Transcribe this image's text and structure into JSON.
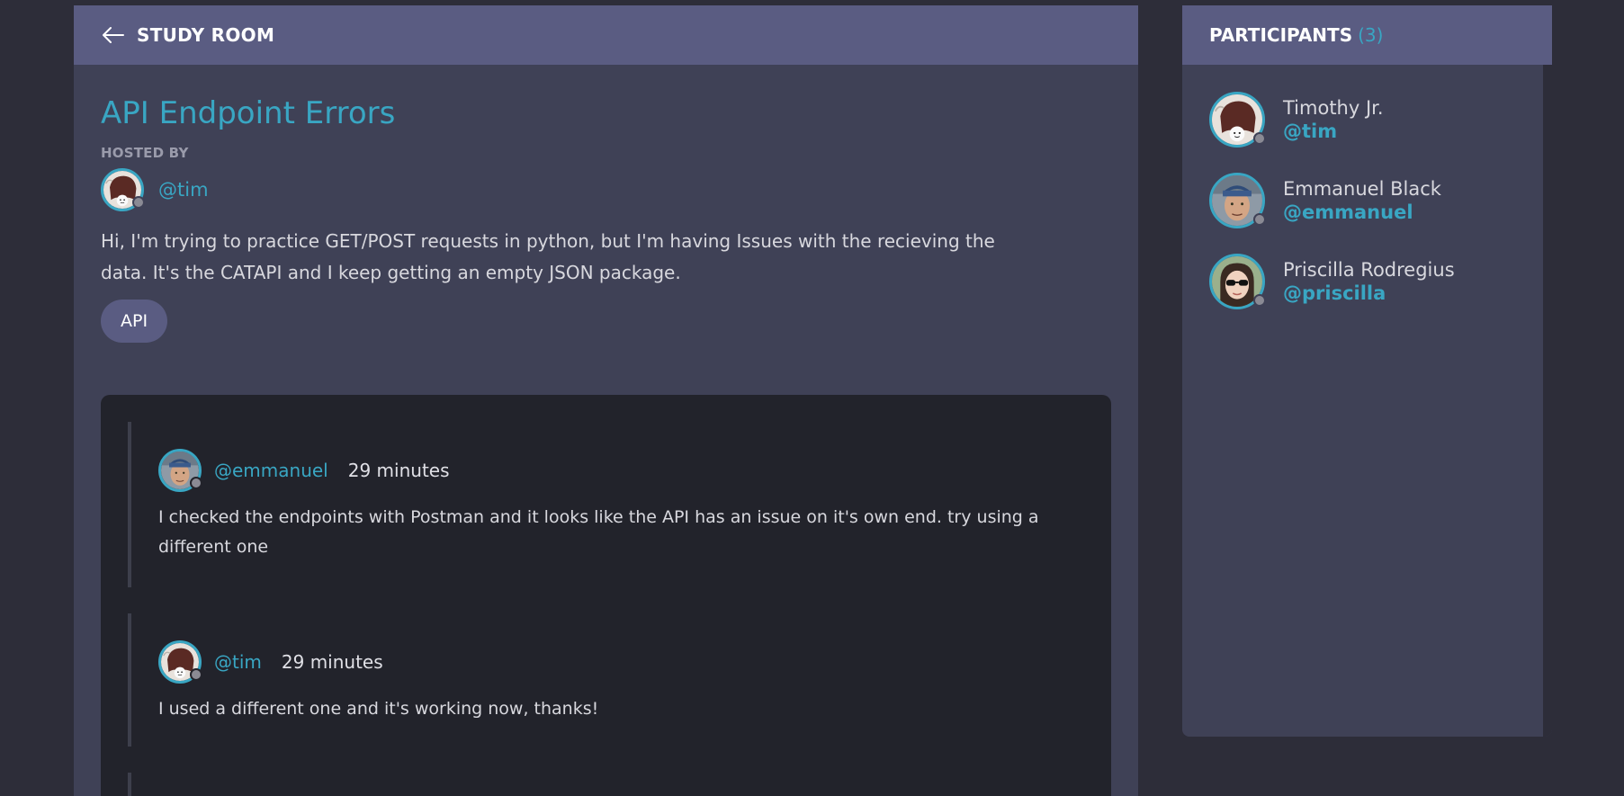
{
  "room": {
    "header_title": "STUDY ROOM",
    "title": "API Endpoint Errors",
    "hosted_by_label": "HOSTED BY",
    "host_handle": "@tim",
    "description": "Hi, I'm trying to practice GET/POST requests in python, but I'm having Issues with the recieving the data. It's the CATAPI and I keep getting an empty JSON package.",
    "topic": "API"
  },
  "messages": [
    {
      "user": "@emmanuel",
      "time": "29 minutes",
      "text": "I checked the endpoints with Postman and it looks like the API has an issue on it's own end. try using a different one"
    },
    {
      "user": "@tim",
      "time": "29 minutes",
      "text": "I used a different one and it's working now, thanks!"
    }
  ],
  "participants": {
    "title": "PARTICIPANTS",
    "count": "(3)",
    "items": [
      {
        "name": "Timothy Jr.",
        "handle": "@tim"
      },
      {
        "name": "Emmanuel Black",
        "handle": "@emmanuel"
      },
      {
        "name": "Priscilla Rodregius",
        "handle": "@priscilla"
      }
    ]
  },
  "colors": {
    "accent": "#39a6c3",
    "header": "#5a5c82",
    "panel": "#3f4156",
    "background": "#2d2d39",
    "conversation": "#22232b"
  }
}
